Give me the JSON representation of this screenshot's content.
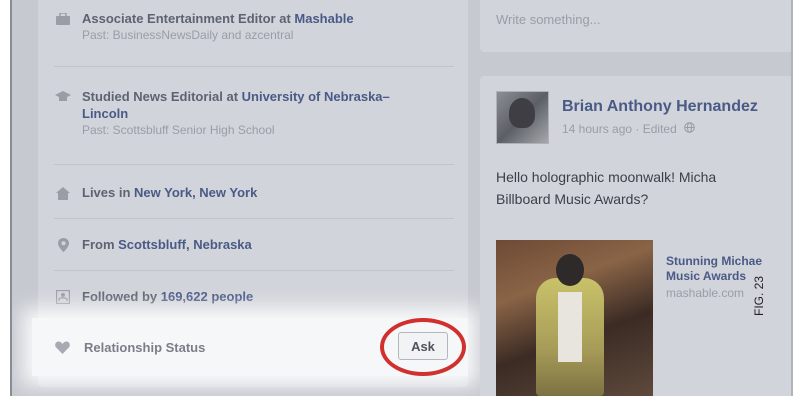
{
  "about": {
    "items": [
      {
        "icon": "briefcase-icon",
        "text": "Associate Entertainment Editor at ",
        "link": "Mashable",
        "sub": "Past: BusinessNewsDaily and azcentral"
      },
      {
        "icon": "graduation-cap-icon",
        "text": "Studied News Editorial at ",
        "link": "University of Nebraska–Lincoln",
        "sub": "Past: Scottsbluff Senior High School"
      },
      {
        "icon": "house-icon",
        "text": "Lives in ",
        "link": "New York, New York",
        "sub": ""
      },
      {
        "icon": "location-pin-icon",
        "text": "From ",
        "link": "Scottsbluff, Nebraska",
        "sub": ""
      },
      {
        "icon": "followers-icon",
        "text": "Followed by ",
        "link": "169,622 people",
        "sub": ""
      }
    ],
    "relationship": {
      "label": "Relationship Status",
      "button": "Ask",
      "icon": "heart-icon"
    }
  },
  "composer": {
    "placeholder": "Write something..."
  },
  "post": {
    "author": "Brian Anthony Hernandez",
    "meta": "14 hours ago · Edited",
    "text_line1": "Hello holographic moonwalk! Micha",
    "text_line2": "Billboard Music Awards?",
    "link_title": "Stunning Michae Music Awards",
    "link_title_line1": "Stunning Michae",
    "link_title_line2": "Music Awards",
    "link_domain": "mashable.com"
  },
  "figure_label": "FIG. 23",
  "colors": {
    "link": "#4a5a86",
    "highlight_circle": "#d0302e",
    "panel": "#d1d4da"
  }
}
